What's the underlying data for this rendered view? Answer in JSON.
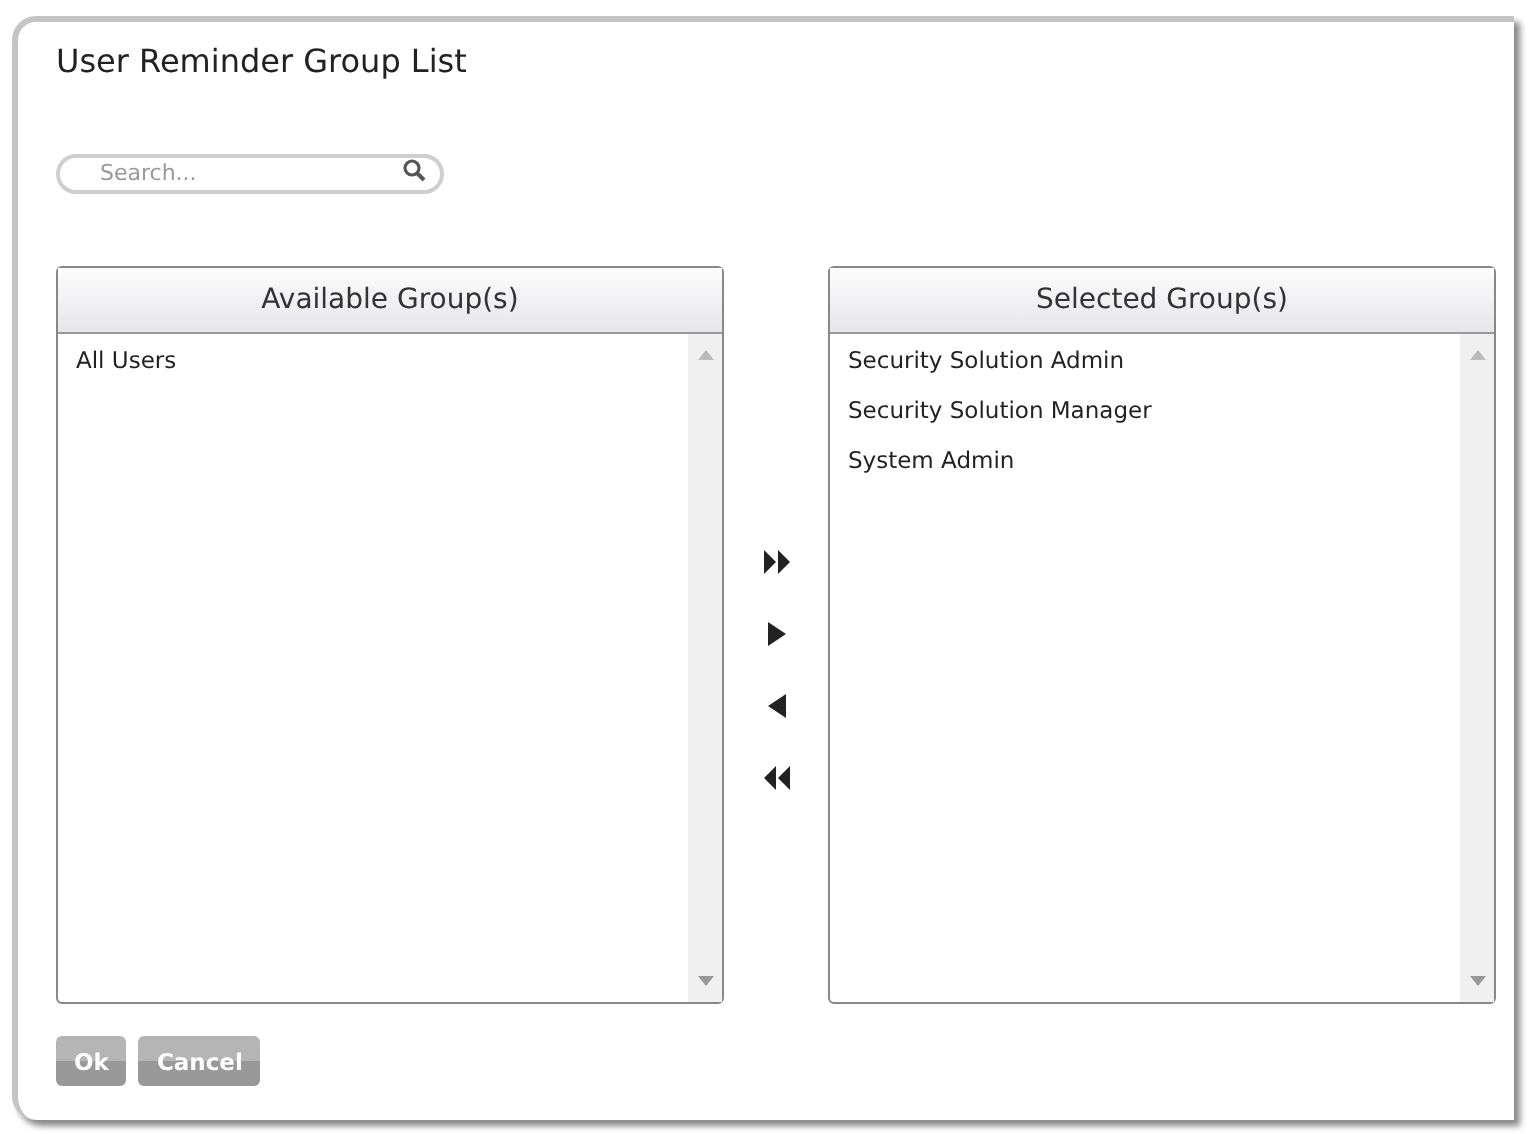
{
  "dialog": {
    "title": "User Reminder Group List"
  },
  "search": {
    "placeholder": "Search..."
  },
  "available": {
    "header": "Available Group(s)",
    "items": [
      "All Users"
    ]
  },
  "transfer_buttons": [
    {
      "kind": "all_right"
    },
    {
      "kind": "right"
    },
    {
      "kind": "left"
    },
    {
      "kind": "all_left"
    }
  ],
  "selected": {
    "header": "Selected Group(s)",
    "items": [
      "Security Solution Admin",
      "Security Solution Manager",
      "System Admin"
    ]
  },
  "buttons": [
    "Ok",
    "Cancel"
  ]
}
